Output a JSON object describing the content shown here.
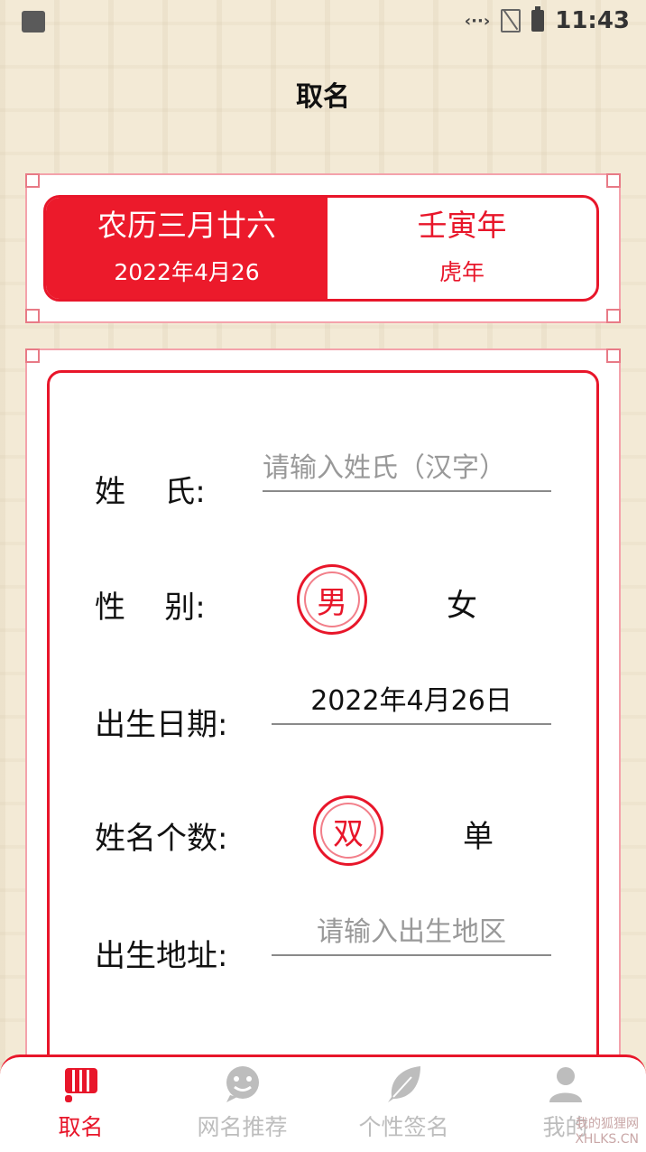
{
  "status_bar": {
    "time": "11:43"
  },
  "header": {
    "title": "取名"
  },
  "date_card": {
    "lunar_date": "农历三月廿六",
    "solar_date": "2022年4月26",
    "ganzhi_year": "壬寅年",
    "zodiac_year": "虎年"
  },
  "form": {
    "surname": {
      "label": "姓    氏:",
      "placeholder": "请输入姓氏（汉字）"
    },
    "gender": {
      "label": "性    别:",
      "options": [
        "男",
        "女"
      ],
      "selected": "男"
    },
    "birth_date": {
      "label": "出生日期:",
      "value": "2022年4月26日"
    },
    "name_length": {
      "label": "姓名个数:",
      "options": [
        "双",
        "单"
      ],
      "selected": "双"
    },
    "birth_place": {
      "label": "出生地址:",
      "placeholder": "请输入出生地区"
    }
  },
  "tabbar": {
    "items": [
      {
        "label": "取名",
        "icon": "naming-scroll-icon",
        "active": true
      },
      {
        "label": "网名推荐",
        "icon": "chat-face-icon",
        "active": false
      },
      {
        "label": "个性签名",
        "icon": "feather-icon",
        "active": false
      },
      {
        "label": "我的",
        "icon": "user-icon",
        "active": false
      }
    ]
  },
  "watermark": {
    "line1": "我的狐狸网",
    "line2": "XHLKS.CN"
  },
  "colors": {
    "accent": "#e8162a",
    "inactive": "#bdbdbd",
    "background": "#f3ead6"
  }
}
